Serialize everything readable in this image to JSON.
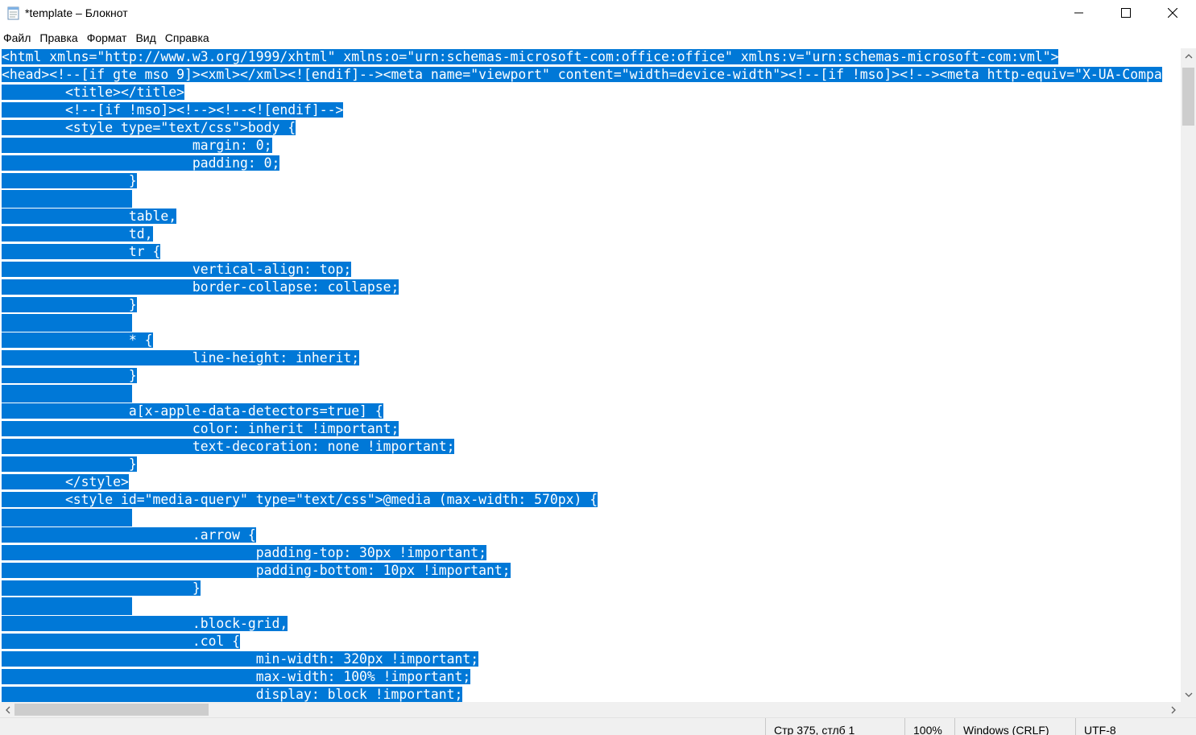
{
  "window": {
    "title": "*template – Блокнот"
  },
  "menu": {
    "items": [
      "Файл",
      "Правка",
      "Формат",
      "Вид",
      "Справка"
    ]
  },
  "editor": {
    "lines": [
      {
        "text": "<html xmlns=\"http://www.w3.org/1999/xhtml\" xmlns:o=\"urn:schemas-microsoft-com:office:office\" xmlns:v=\"urn:schemas-microsoft-com:vml\">"
      },
      {
        "text": "<head><!--[if gte mso 9]><xml></xml><![endif]--><meta name=\"viewport\" content=\"width=device-width\"><!--[if !mso]><!--><meta http-equiv=\"X-UA-Compa"
      },
      {
        "text": "        <title></title>"
      },
      {
        "text": "        <!--[if !mso]><!--><!--<![endif]-->"
      },
      {
        "text": "        <style type=\"text/css\">body {"
      },
      {
        "text": "                        margin: 0;"
      },
      {
        "text": "                        padding: 0;"
      },
      {
        "text": "                }"
      },
      {
        "text": ""
      },
      {
        "text": "                table,"
      },
      {
        "text": "                td,"
      },
      {
        "text": "                tr {"
      },
      {
        "text": "                        vertical-align: top;"
      },
      {
        "text": "                        border-collapse: collapse;"
      },
      {
        "text": "                }"
      },
      {
        "text": ""
      },
      {
        "text": "                * {"
      },
      {
        "text": "                        line-height: inherit;"
      },
      {
        "text": "                }"
      },
      {
        "text": ""
      },
      {
        "text": "                a[x-apple-data-detectors=true] {"
      },
      {
        "text": "                        color: inherit !important;"
      },
      {
        "text": "                        text-decoration: none !important;"
      },
      {
        "text": "                }"
      },
      {
        "text": "        </style>"
      },
      {
        "text": "        <style id=\"media-query\" type=\"text/css\">@media (max-width: 570px) {"
      },
      {
        "text": ""
      },
      {
        "text": "                        .arrow {"
      },
      {
        "text": "                                padding-top: 30px !important;"
      },
      {
        "text": "                                padding-bottom: 10px !important;"
      },
      {
        "text": "                        }"
      },
      {
        "text": ""
      },
      {
        "text": "                        .block-grid,"
      },
      {
        "text": "                        .col {"
      },
      {
        "text": "                                min-width: 320px !important;"
      },
      {
        "text": "                                max-width: 100% !important;"
      },
      {
        "text": "                                display: block !important;"
      }
    ],
    "selection_color": "#0078d7"
  },
  "status": {
    "position": "Стр 375, стлб 1",
    "zoom": "100%",
    "line_endings": "Windows (CRLF)",
    "encoding": "UTF-8"
  }
}
